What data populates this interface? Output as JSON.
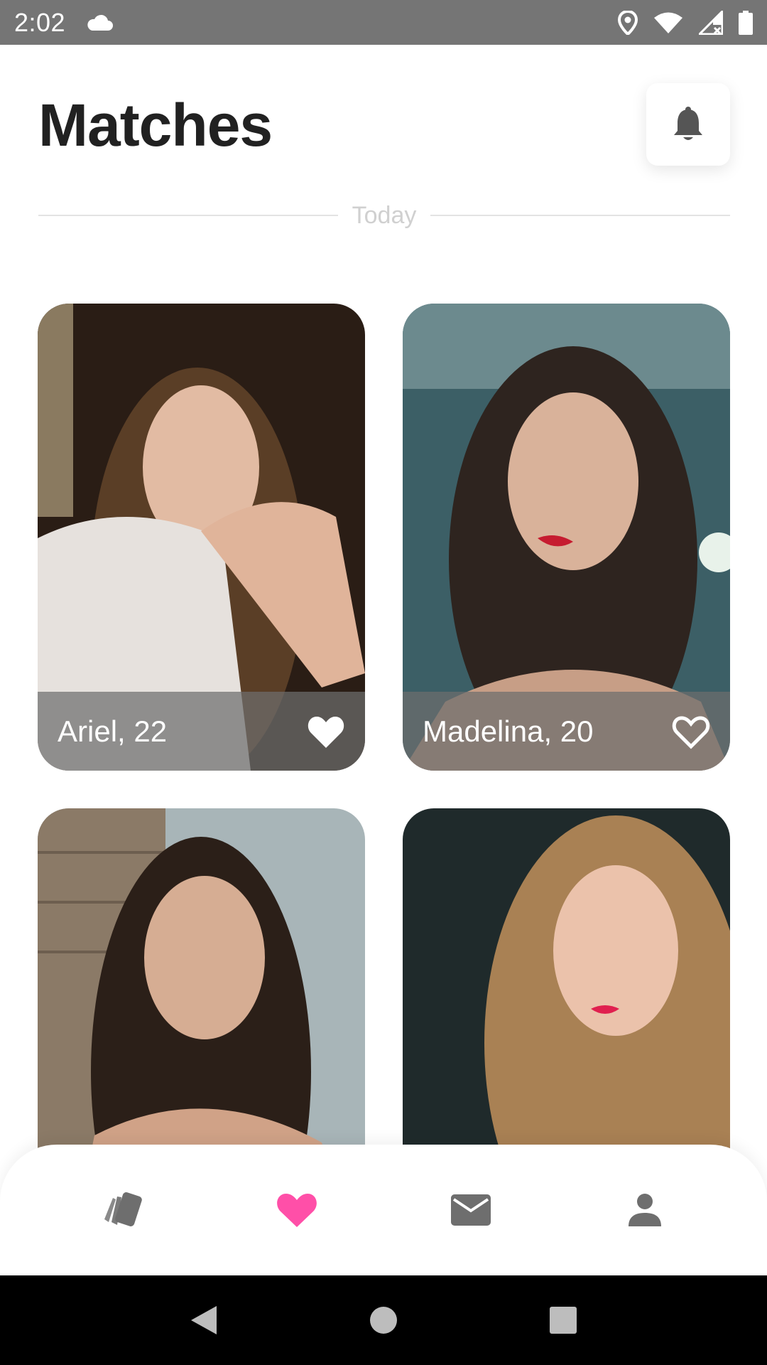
{
  "status_bar": {
    "time": "2:02",
    "icons": [
      "cloud-icon",
      "location-icon",
      "wifi-icon",
      "signal-icon",
      "battery-icon"
    ]
  },
  "header": {
    "title": "Matches",
    "notification_icon": "bell-icon"
  },
  "section": {
    "label": "Today"
  },
  "matches": [
    {
      "name_age": "Ariel, 22",
      "liked": true
    },
    {
      "name_age": "Madelina, 20",
      "liked": false
    },
    {
      "name_age": "",
      "liked": null
    },
    {
      "name_age": "",
      "liked": null
    }
  ],
  "bottom_nav": {
    "items": [
      {
        "icon": "cards-icon",
        "active": false
      },
      {
        "icon": "heart-icon",
        "active": true
      },
      {
        "icon": "mail-icon",
        "active": false
      },
      {
        "icon": "person-icon",
        "active": false
      }
    ],
    "active_color": "#FF4FA8",
    "inactive_color": "#6E6E6E"
  },
  "system_nav": [
    "back-icon",
    "home-icon",
    "recents-icon"
  ]
}
